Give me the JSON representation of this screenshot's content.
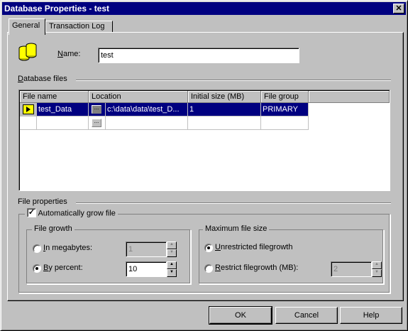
{
  "window": {
    "title": "Database Properties - test",
    "close_glyph": "✕"
  },
  "tabs": [
    {
      "label": "General",
      "active": true
    },
    {
      "label": "Transaction Log",
      "active": false
    }
  ],
  "general": {
    "name_label_mnemonic": "N",
    "name_label_rest": "ame:",
    "name_value": "test",
    "database_files_mnemonic": "D",
    "database_files_rest": "atabase files",
    "icon": "database-icon"
  },
  "files_grid": {
    "columns": [
      "File name",
      "Location",
      "Initial size (MB)",
      "File group"
    ],
    "rows": [
      {
        "file_name": "test_Data",
        "location": "c:\\data\\data\\test_D...",
        "initial_size": "1",
        "file_group": "PRIMARY",
        "selected": true
      },
      {
        "file_name": "",
        "location": "",
        "initial_size": "",
        "file_group": "",
        "selected": false
      }
    ],
    "browse_glyph": "..."
  },
  "file_properties": {
    "section_label": "File properties",
    "auto_grow_label_pre": "Automatically ",
    "auto_grow_label_mnemonic": "g",
    "auto_grow_label_post": "row file",
    "auto_grow_checked": true,
    "check_glyph": "✓"
  },
  "file_growth": {
    "title": "File growth",
    "in_megabytes_mnemonic": "I",
    "in_megabytes_rest": "n megabytes:",
    "in_megabytes_value": "1",
    "by_percent_mnemonic": "B",
    "by_percent_rest": "y percent:",
    "by_percent_value": "10",
    "selected": "by_percent"
  },
  "max_file_size": {
    "title": "Maximum file size",
    "unrestricted_mnemonic": "U",
    "unrestricted_rest": "nrestricted filegrowth",
    "restrict_mnemonic": "R",
    "restrict_rest": "estrict filegrowth (MB):",
    "restrict_value": "2",
    "selected": "unrestricted"
  },
  "buttons": {
    "ok": "OK",
    "cancel": "Cancel",
    "help": "Help"
  },
  "spin_glyphs": {
    "up": "▲",
    "down": "▼"
  }
}
